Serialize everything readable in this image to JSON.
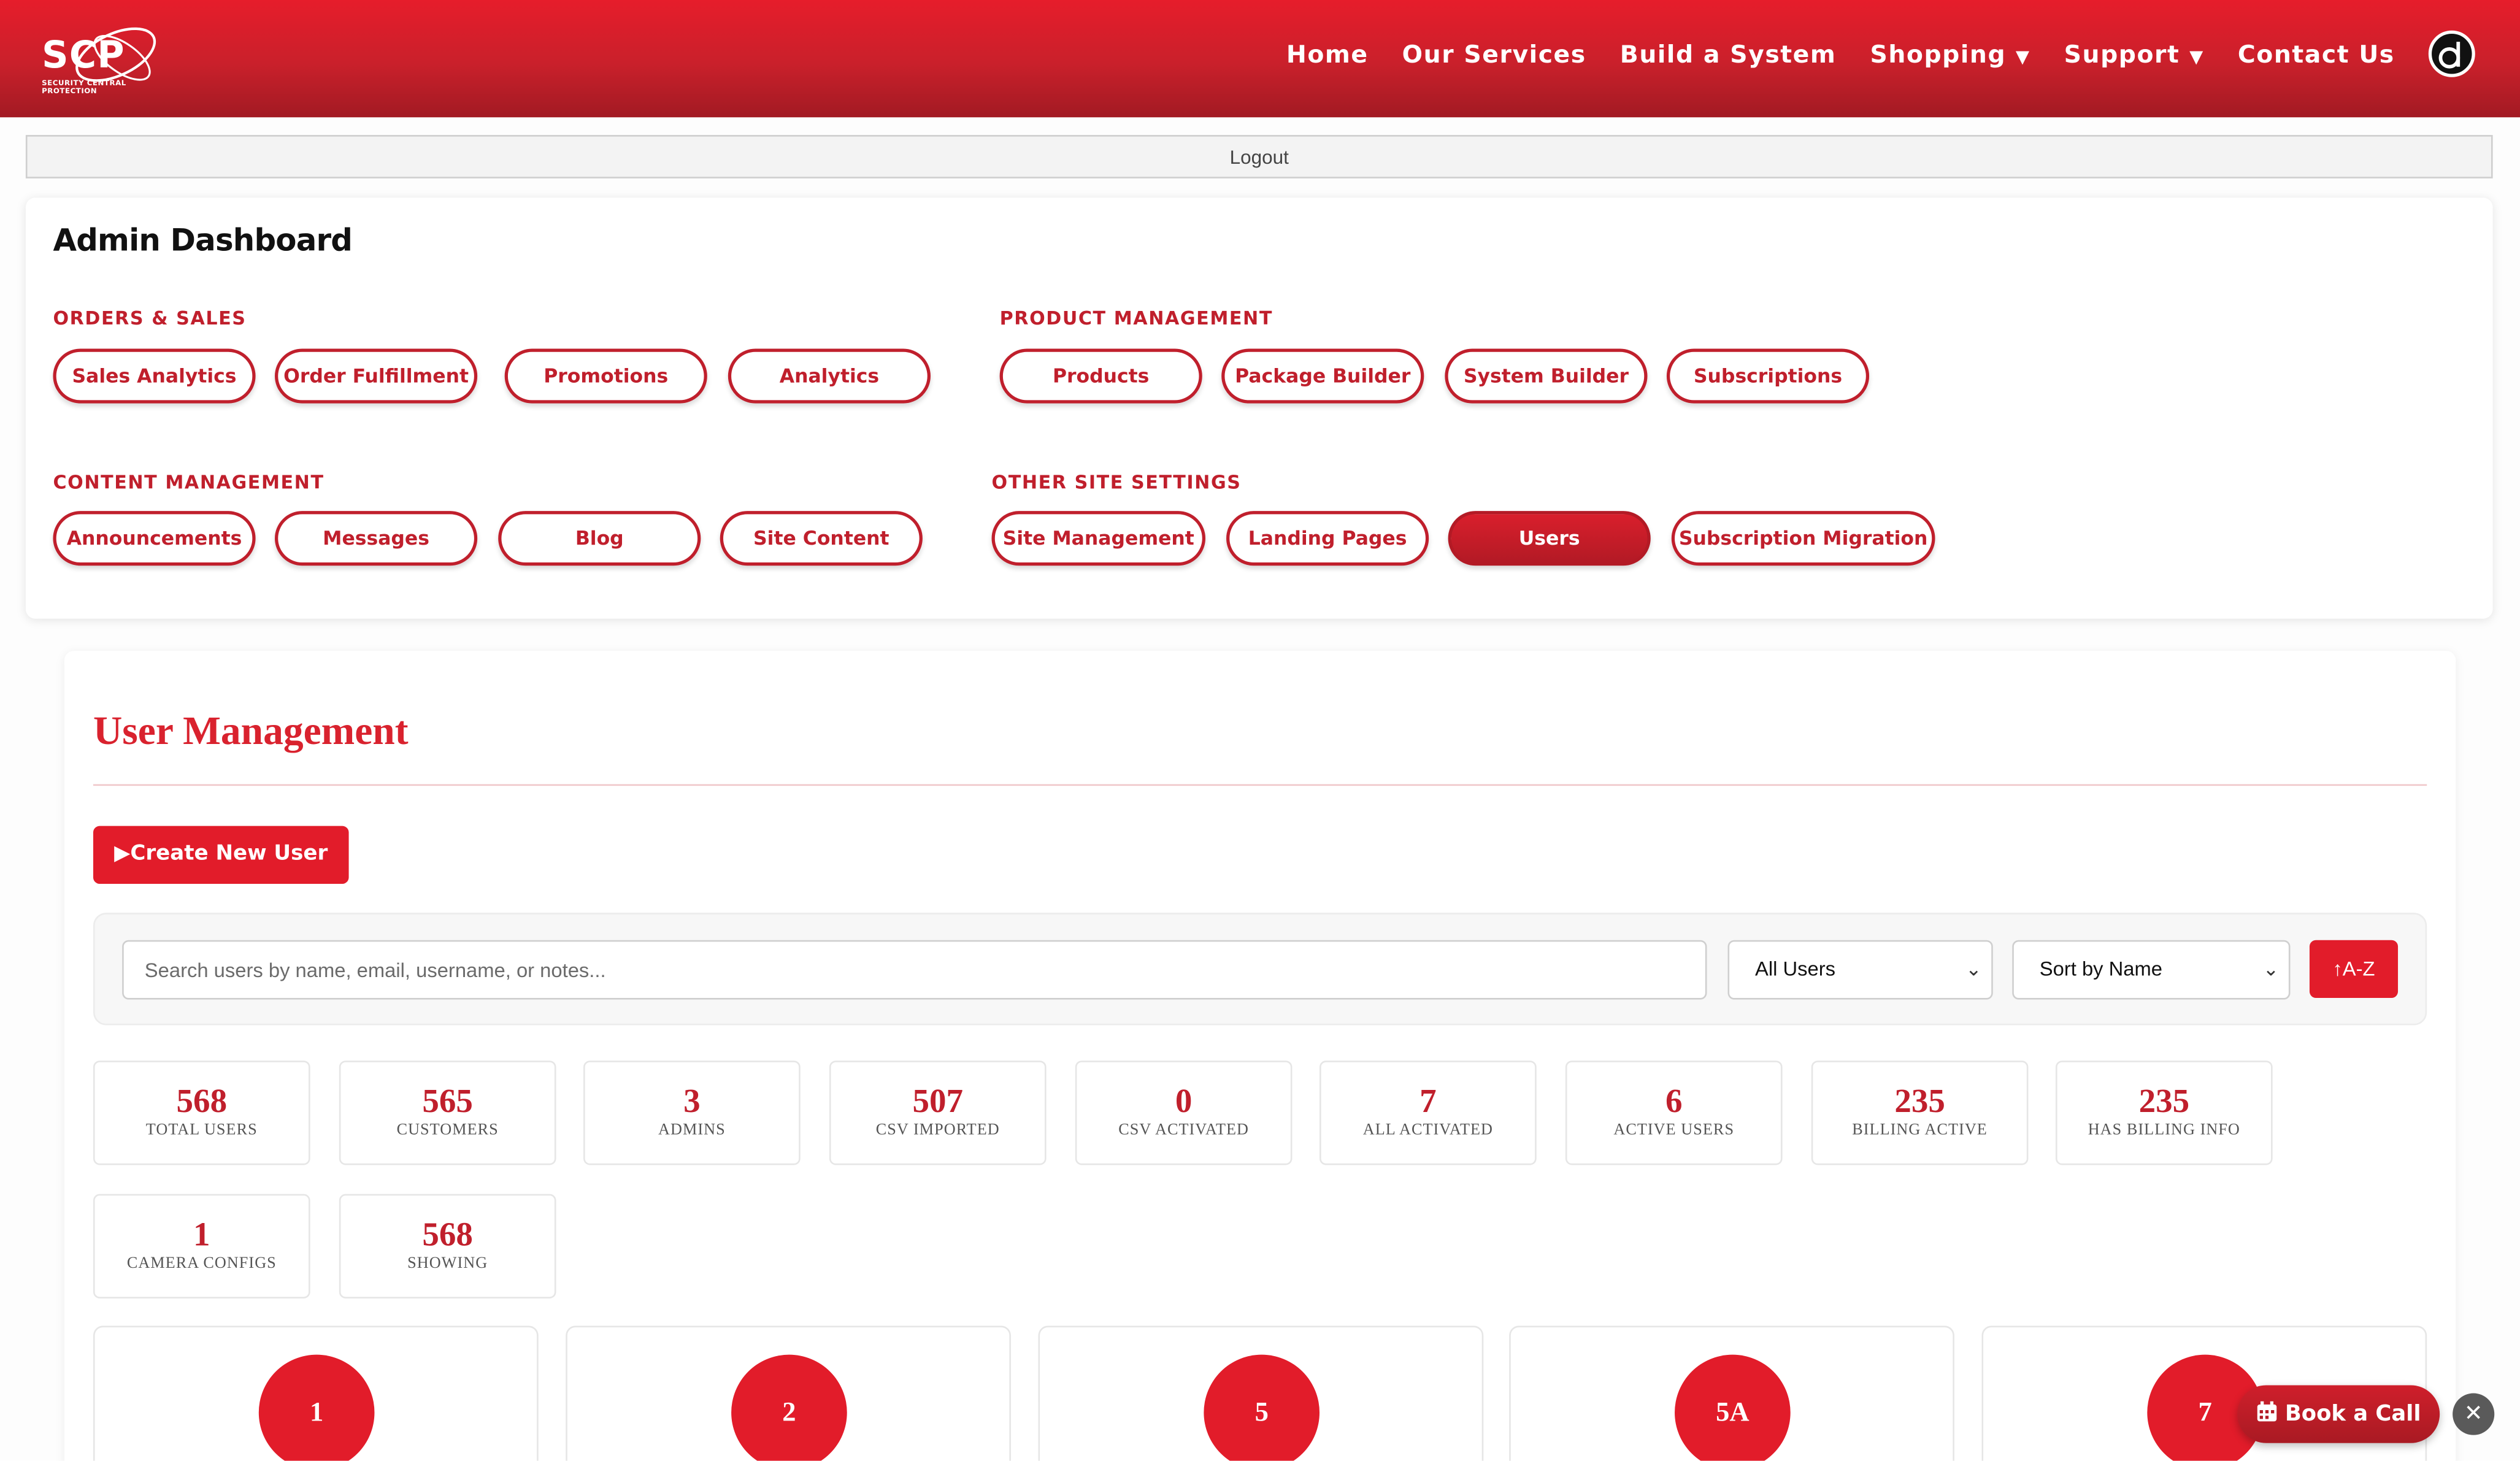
{
  "header": {
    "logo_text": "SCP",
    "logo_subtext": "SECURITY CENTRAL PROTECTION",
    "nav": [
      {
        "label": "Home"
      },
      {
        "label": "Our Services"
      },
      {
        "label": "Build a System"
      },
      {
        "label": "Shopping",
        "caret": "▼"
      },
      {
        "label": "Support",
        "caret": "▼"
      },
      {
        "label": "Contact Us"
      }
    ],
    "avatar_letter": "d"
  },
  "logout_label": "Logout",
  "admin": {
    "title": "Admin Dashboard",
    "groups": [
      {
        "title": "ORDERS & SALES",
        "items": [
          "Sales Analytics",
          "Order Fulfillment",
          "Promotions",
          "Analytics"
        ]
      },
      {
        "title": "PRODUCT MANAGEMENT",
        "items": [
          "Products",
          "Package Builder",
          "System Builder",
          "Subscriptions"
        ]
      },
      {
        "title": "CONTENT MANAGEMENT",
        "items": [
          "Announcements",
          "Messages",
          "Blog",
          "Site Content"
        ]
      },
      {
        "title": "OTHER SITE SETTINGS",
        "items": [
          "Site Management",
          "Landing Pages",
          "Users",
          "Subscription Migration"
        ]
      }
    ],
    "active_item": "Users"
  },
  "user_management": {
    "title": "User Management",
    "create_label": "▶Create New User",
    "search_placeholder": "Search users by name, email, username, or notes...",
    "filter_selected": "All Users",
    "sort_selected": "Sort by Name",
    "sort_dir_label": "↑A-Z",
    "stats": [
      {
        "value": "568",
        "label": "TOTAL USERS"
      },
      {
        "value": "565",
        "label": "CUSTOMERS"
      },
      {
        "value": "3",
        "label": "ADMINS"
      },
      {
        "value": "507",
        "label": "CSV IMPORTED"
      },
      {
        "value": "0",
        "label": "CSV ACTIVATED"
      },
      {
        "value": "7",
        "label": "ALL ACTIVATED"
      },
      {
        "value": "6",
        "label": "ACTIVE USERS"
      },
      {
        "value": "235",
        "label": "BILLING ACTIVE"
      },
      {
        "value": "235",
        "label": "HAS BILLING INFO"
      },
      {
        "value": "1",
        "label": "CAMERA CONFIGS"
      },
      {
        "value": "568",
        "label": "SHOWING"
      }
    ],
    "group_cards": [
      "1",
      "2",
      "5",
      "5A",
      "7"
    ]
  },
  "book_call_label": "Book a Call",
  "book_call_icon": "calendar-icon",
  "close_label": "✕",
  "colors": {
    "brand_red": "#e21c2a",
    "dark_red": "#b31a25",
    "label_red": "#c01f2c"
  }
}
